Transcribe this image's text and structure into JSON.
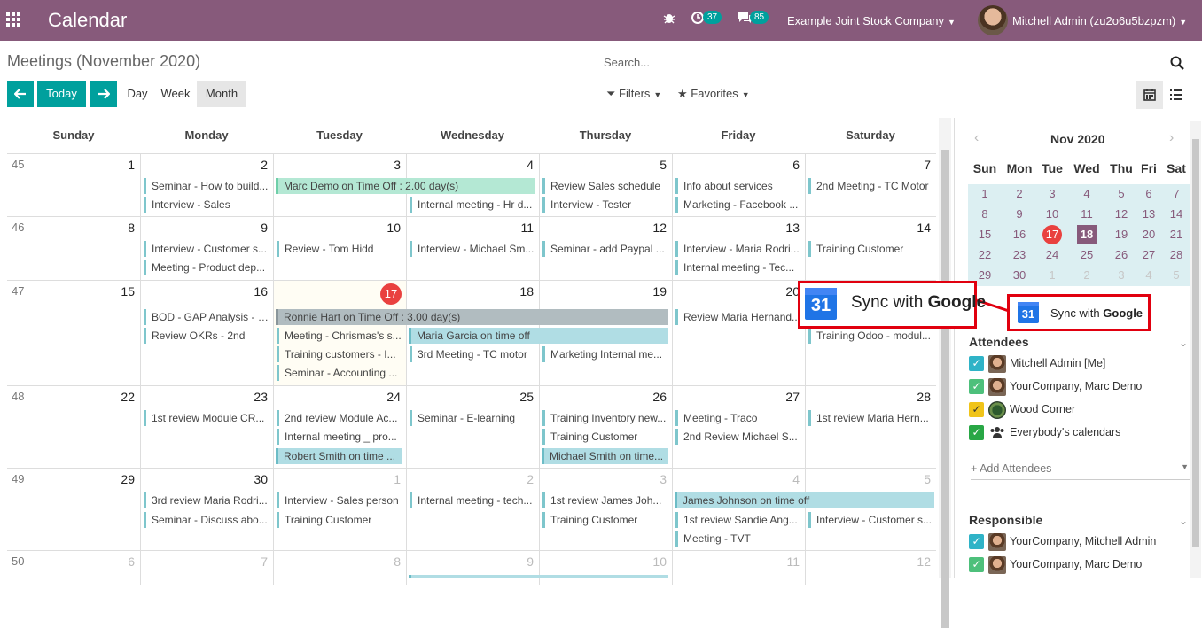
{
  "navbar": {
    "app_title": "Calendar",
    "activity_count": "37",
    "messages_count": "85",
    "company": "Example Joint Stock Company",
    "user": "Mitchell Admin (zu2o6u5bzpzm)"
  },
  "control": {
    "breadcrumb": "Meetings (November 2020)",
    "search_placeholder": "Search...",
    "today": "Today",
    "views": {
      "day": "Day",
      "week": "Week",
      "month": "Month"
    },
    "filters": "Filters",
    "favorites": "Favorites"
  },
  "calendar": {
    "weekdays": [
      "Sunday",
      "Monday",
      "Tuesday",
      "Wednesday",
      "Thursday",
      "Friday",
      "Saturday"
    ],
    "weeks": [
      {
        "num": "45",
        "days": [
          "1",
          "2",
          "3",
          "4",
          "5",
          "6",
          "7"
        ]
      },
      {
        "num": "46",
        "days": [
          "8",
          "9",
          "10",
          "11",
          "12",
          "13",
          "14"
        ]
      },
      {
        "num": "47",
        "days": [
          "15",
          "16",
          "17",
          "18",
          "19",
          "20",
          "21"
        ]
      },
      {
        "num": "48",
        "days": [
          "22",
          "23",
          "24",
          "25",
          "26",
          "27",
          "28"
        ]
      },
      {
        "num": "49",
        "days": [
          "29",
          "30",
          "1",
          "2",
          "3",
          "4",
          "5"
        ]
      },
      {
        "num": "50",
        "days": [
          "6",
          "7",
          "8",
          "9",
          "10",
          "11",
          "12"
        ]
      }
    ],
    "events": {
      "w0": [
        "Seminar - How to build...",
        "Interview - Sales",
        "Marc Demo on Time Off : 2.00 day(s)",
        "Internal meeting - Hr d...",
        "Review Sales schedule",
        "Interview - Tester",
        "Info about services",
        "Marketing - Facebook ...",
        "2nd Meeting - TC Motor"
      ],
      "w1": [
        "Interview - Customer s...",
        "Meeting - Product dep...",
        "Review - Tom Hidd",
        "Interview - Michael Sm...",
        "Seminar - add Paypal ...",
        "Interview - Maria Rodri...",
        "Internal meeting - Tec...",
        "Training Customer"
      ],
      "w2": [
        "BOD - GAP Analysis - 1...",
        "Review OKRs - 2nd",
        "Ronnie Hart on Time Off : 3.00 day(s)",
        "Meeting - Chrismas's s...",
        "Training customers - I...",
        "Seminar - Accounting ...",
        "Maria Garcia on time off",
        "3rd Meeting - TC motor",
        "Marketing Internal me...",
        "Review Maria Hernand...",
        "Training Odoo - modul..."
      ],
      "w3": [
        "1st review Module CR...",
        "2nd review Module Ac...",
        "Internal meeting _ pro...",
        "Robert Smith on time ...",
        "Seminar - E-learning",
        "Training Inventory new...",
        "Training Customer",
        "Michael Smith on time...",
        "Meeting - Traco",
        "2nd Review Michael S...",
        "1st review Maria Hern..."
      ],
      "w4": [
        "3rd review Maria Rodri...",
        "Seminar - Discuss abo...",
        "Interview - Sales person",
        "Training Customer",
        "Internal meeting - tech...",
        "1st review James Joh...",
        "Training Customer",
        "James Johnson on time off",
        "1st review Sandie Ang...",
        "Meeting - TVT",
        "Interview - Customer s..."
      ]
    }
  },
  "mini_cal": {
    "title": "Nov 2020",
    "prev": "‹",
    "next": "›",
    "dow": [
      "Sun",
      "Mon",
      "Tue",
      "Wed",
      "Thu",
      "Fri",
      "Sat"
    ],
    "rows": [
      [
        "1",
        "2",
        "3",
        "4",
        "5",
        "6",
        "7"
      ],
      [
        "8",
        "9",
        "10",
        "11",
        "12",
        "13",
        "14"
      ],
      [
        "15",
        "16",
        "17",
        "18",
        "19",
        "20",
        "21"
      ],
      [
        "22",
        "23",
        "24",
        "25",
        "26",
        "27",
        "28"
      ],
      [
        "29",
        "30",
        "1",
        "2",
        "3",
        "4",
        "5"
      ]
    ],
    "today": "17",
    "selected": "18"
  },
  "sync": {
    "logo": "31",
    "prefix": "Sync with",
    "brand": "Google"
  },
  "attendees": {
    "title": "Attendees",
    "items": [
      "Mitchell Admin [Me]",
      "YourCompany, Marc Demo",
      "Wood Corner",
      "Everybody's calendars"
    ],
    "add": "+ Add Attendees"
  },
  "responsible": {
    "title": "Responsible",
    "items": [
      "YourCompany, Mitchell Admin",
      "YourCompany, Marc Demo"
    ]
  },
  "colors": {
    "brand": "#875a7b",
    "primary": "#00a09d",
    "today": "#e9413f",
    "highlight": "#e1000f"
  }
}
